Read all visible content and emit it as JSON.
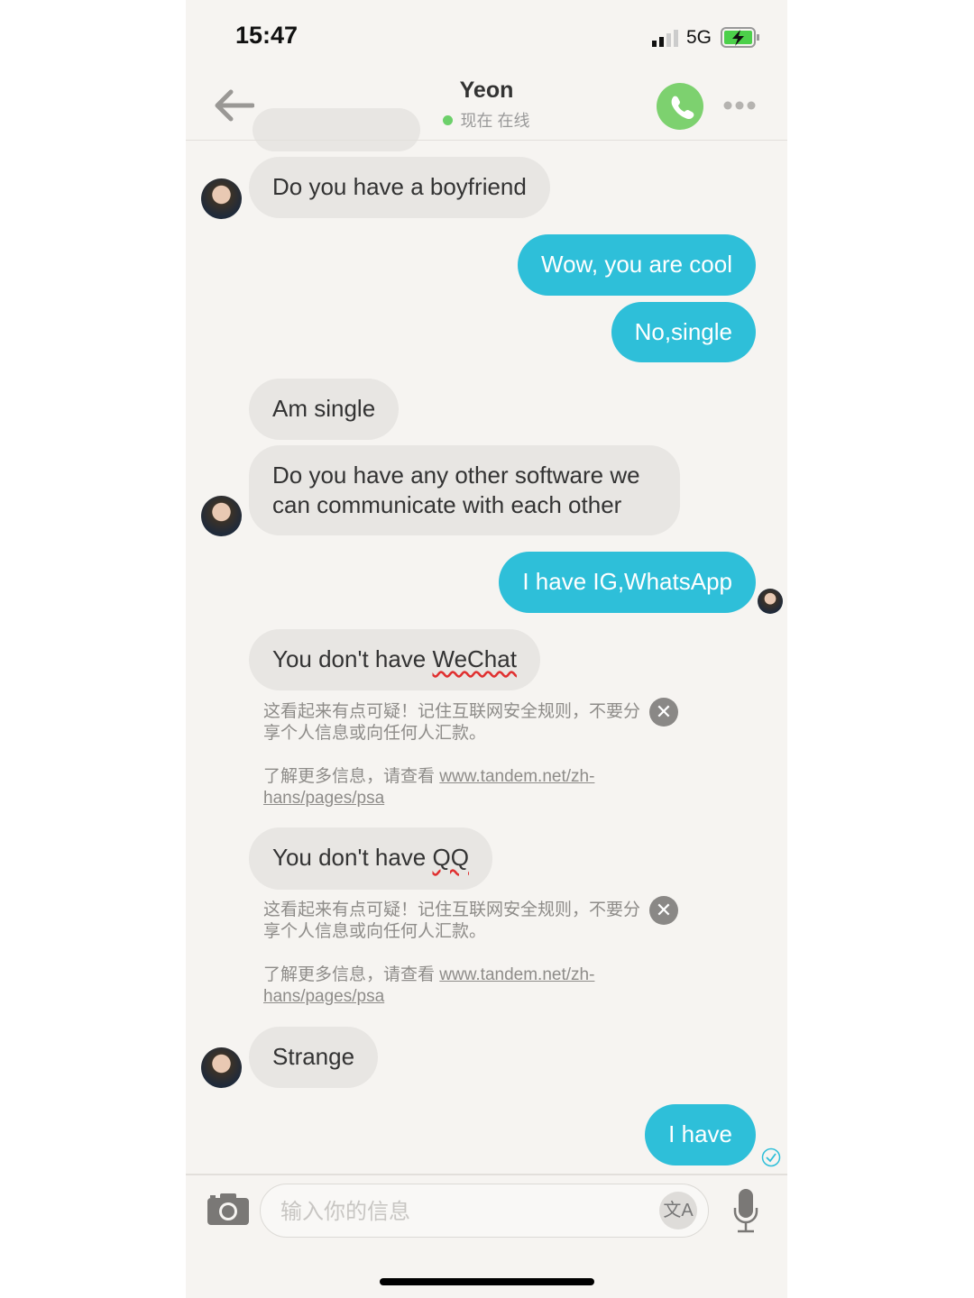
{
  "status_bar": {
    "time": "15:47",
    "network": "5G",
    "signal_bars": 2,
    "battery": "charging"
  },
  "header": {
    "back_icon": "arrow-left",
    "title": "Yeon",
    "status": "现在 在线",
    "status_color": "#6cd06a",
    "call_icon": "phone",
    "more_icon": "ellipsis"
  },
  "messages": [
    {
      "dir": "in",
      "text": "Do you have a boyfriend"
    },
    {
      "dir": "out",
      "text": "Wow, you are cool"
    },
    {
      "dir": "out",
      "text": "No,single"
    },
    {
      "dir": "in",
      "text": "Am single"
    },
    {
      "dir": "in",
      "text": "Do you have any other software we can communicate with each other"
    },
    {
      "dir": "out",
      "text": "I have IG,WhatsApp"
    },
    {
      "dir": "in",
      "text_prefix": "You don't have ",
      "text_flag": "WeChat"
    },
    {
      "dir": "in",
      "text_prefix": "You don't have ",
      "text_flag": "QQ"
    },
    {
      "dir": "in",
      "text": "Strange"
    },
    {
      "dir": "out",
      "text": "I have",
      "read": true
    }
  ],
  "warning": {
    "text": "这看起来有点可疑！记住互联网安全规则，不要分享个人信息或向任何人汇款。",
    "more": "了解更多信息，请查看 ",
    "link": "www.tandem.net/zh-hans/pages/psa"
  },
  "composer": {
    "placeholder": "输入你的信息",
    "translate_label": "文A"
  },
  "colors": {
    "background": "#f6f4f1",
    "incoming": "#e8e6e3",
    "outgoing": "#2ebfd9",
    "call": "#7dd16f"
  }
}
